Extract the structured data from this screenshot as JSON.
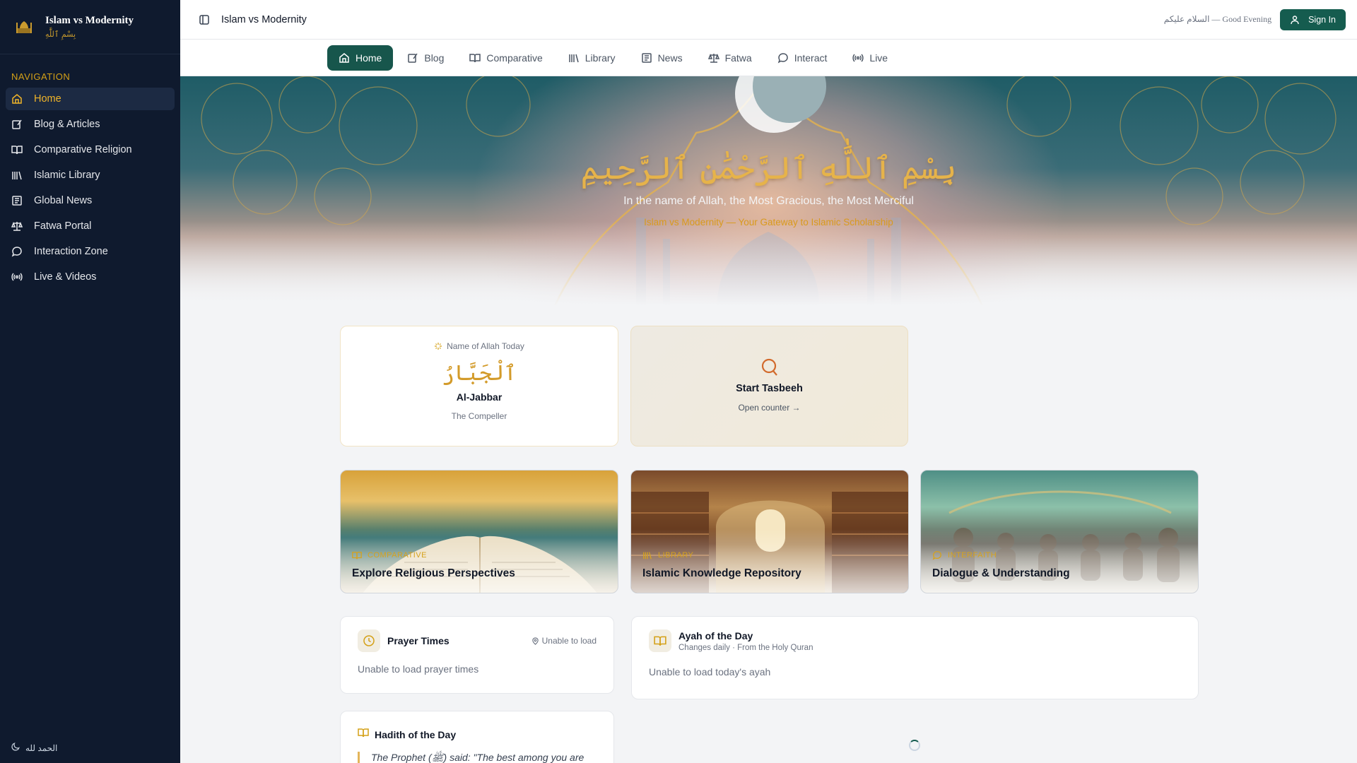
{
  "colors": {
    "sidebar_bg": "#0f1a2e",
    "accent_gold": "#d4a017",
    "primary_green": "#155c4f"
  },
  "sidebar": {
    "brand_title": "Islam vs Modernity",
    "brand_subtitle": "بِسْمِ ٱللَّٰهِ",
    "nav_heading": "NAVIGATION",
    "items": [
      {
        "label": "Home",
        "icon": "home-icon"
      },
      {
        "label": "Blog & Articles",
        "icon": "edit-icon"
      },
      {
        "label": "Comparative Religion",
        "icon": "book-open-icon"
      },
      {
        "label": "Islamic Library",
        "icon": "library-icon"
      },
      {
        "label": "Global News",
        "icon": "newspaper-icon"
      },
      {
        "label": "Fatwa Portal",
        "icon": "scale-icon"
      },
      {
        "label": "Interaction Zone",
        "icon": "chat-icon"
      },
      {
        "label": "Live & Videos",
        "icon": "broadcast-icon"
      }
    ],
    "footer": "الحمد لله"
  },
  "topbar": {
    "title": "Islam vs Modernity",
    "greeting": "السلام عليكم — Good Evening",
    "signin": "Sign In"
  },
  "tabs": [
    {
      "label": "Home"
    },
    {
      "label": "Blog"
    },
    {
      "label": "Comparative"
    },
    {
      "label": "Library"
    },
    {
      "label": "News"
    },
    {
      "label": "Fatwa"
    },
    {
      "label": "Interact"
    },
    {
      "label": "Live"
    }
  ],
  "hero": {
    "arabic": "بِسْمِ ٱللَّٰهِ ٱلرَّحْمَٰنِ ٱلرَّحِيمِ",
    "english": "In the name of Allah, the Most Gracious, the Most Merciful",
    "tagline": "Islam vs Modernity — Your Gateway to Islamic Scholarship"
  },
  "name_of_allah": {
    "label": "Name of Allah Today",
    "arabic": "ٱلْجَبَّارُ",
    "transliteration": "Al-Jabbar",
    "meaning": "The Compeller"
  },
  "tasbeeh": {
    "title": "Start Tasbeeh",
    "link": "Open counter →"
  },
  "features": [
    {
      "category": "COMPARATIVE",
      "title": "Explore Religious Perspectives"
    },
    {
      "category": "LIBRARY",
      "title": "Islamic Knowledge Repository"
    },
    {
      "category": "INTERFAITH",
      "title": "Dialogue & Understanding"
    }
  ],
  "prayer": {
    "title": "Prayer Times",
    "location": "Unable to load",
    "message": "Unable to load prayer times"
  },
  "ayah": {
    "title": "Ayah of the Day",
    "subtitle": "Changes daily · From the Holy Quran",
    "message": "Unable to load today's ayah"
  },
  "hadith": {
    "title": "Hadith of the Day",
    "text": "The Prophet (ﷺ) said: \"The best among you are"
  }
}
